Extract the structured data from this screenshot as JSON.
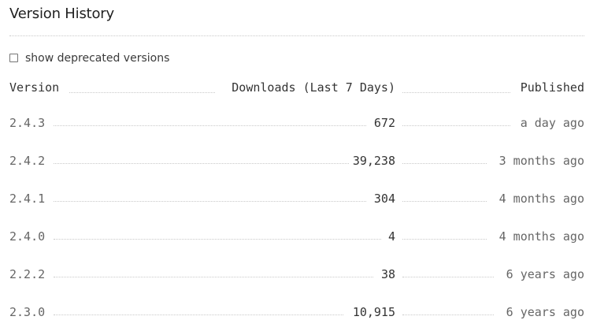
{
  "title": "Version History",
  "show_deprecated": {
    "label": "show deprecated versions",
    "checked": false
  },
  "table": {
    "headers": {
      "version": "Version",
      "downloads": "Downloads (Last 7 Days)",
      "published": "Published"
    },
    "rows": [
      {
        "version": "2.4.3",
        "downloads": "672",
        "published": "a day ago"
      },
      {
        "version": "2.4.2",
        "downloads": "39,238",
        "published": "3 months ago"
      },
      {
        "version": "2.4.1",
        "downloads": "304",
        "published": "4 months ago"
      },
      {
        "version": "2.4.0",
        "downloads": "4",
        "published": "4 months ago"
      },
      {
        "version": "2.2.2",
        "downloads": "38",
        "published": "6 years ago"
      },
      {
        "version": "2.3.0",
        "downloads": "10,915",
        "published": "6 years ago"
      }
    ]
  }
}
